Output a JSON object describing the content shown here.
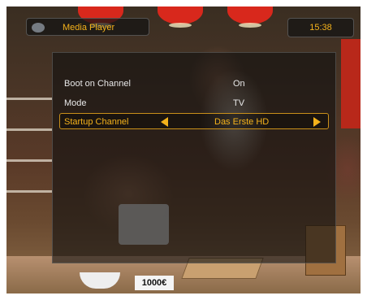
{
  "header": {
    "title": "Media Player",
    "clock": "15:38"
  },
  "settings": {
    "rows": [
      {
        "label": "Boot on Channel",
        "value": "On"
      },
      {
        "label": "Mode",
        "value": "TV"
      },
      {
        "label": "Startup Channel",
        "value": "Das Erste HD"
      }
    ]
  },
  "background": {
    "price_tag": "1000€"
  },
  "colors": {
    "accent": "#f4b21b",
    "panel": "#0f0f0f",
    "text": "#e8e8e8"
  }
}
